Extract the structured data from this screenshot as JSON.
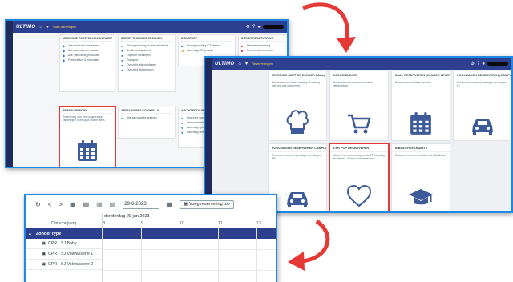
{
  "window1": {
    "logo": "ULTIMO",
    "breadcrumb": "Start Aanvragen",
    "panels": {
      "p1": {
        "title": "Medische toestellen/Ontwerpen",
        "rows": [
          "Alle medische aanvragen",
          "Alle aanvragen en status",
          "Alle (medische) producten",
          "Productfotos & informatie"
        ]
      },
      "p2": {
        "title": "Dienst technische zaken",
        "rows": [
          "Storingsmelding technische dienst",
          "Snelle werkopdracht",
          "Lopende meldingen",
          "Transport",
          "Overzicht alle meldingen",
          "Overzicht afwerkingen"
        ]
      },
      "p3": {
        "title": "Dienst ICT",
        "rows": [
          "Storingsmelding ICT dienst",
          "Aanvraag ICT product"
        ]
      },
      "p4": {
        "title": "Dienst reservering",
        "rows": [
          "Nieuwe reservering",
          "Reservering overzicht"
        ]
      },
      "p5": {
        "title": "Reserveringen",
        "desc": "Reservering voor een vergaderzaal, pandelegen, voertuig of andere items"
      },
      "p6": {
        "title": "Afdelingen/Legionella",
        "rows": [
          "Alle aanvraagformulieren"
        ]
      },
      "p7": {
        "title": "Architectuur & Beheer",
        "rows": [
          "Overzicht van aanvragen",
          "Werkadministratie",
          "Aanvraag oplossen",
          "Aanvraag verbeteren"
        ]
      }
    }
  },
  "window2": {
    "logo": "ULTIMO",
    "breadcrumb": "Reserveringen",
    "cards": [
      {
        "title": "Levering (niet of zonder zaal)",
        "desc": "Reserveren van alleen catering of catering met een zaal reservering",
        "icon": "chef-hat-icon"
      },
      {
        "title": "Uitleendienst",
        "desc": "Reserveren van een product uit de uitleendienst",
        "icon": "shopping-cart-icon"
      },
      {
        "title": "Zaal reserveren (zonder levering)",
        "desc": "Reserveren van alleen een zaal",
        "icon": "calendar-icon"
      },
      {
        "title": "Poolwagen reserveren (campus SJ)",
        "desc": "Reserveren van een poolwagen op campus SJ",
        "icon": "car-icon"
      },
      {
        "title": "Poolwagen reserveren campus MK",
        "desc": "Reserveren van een poolwagen op Campus MK",
        "icon": "car-icon"
      },
      {
        "title": "CPR POP reserveren",
        "desc": "Reserveren van een pop om de CPR-training te oefenen. Graag vooraf reserveren",
        "icon": "heart-icon"
      },
      {
        "title": "Bibliotheekruimte",
        "desc": "Reserveren van een ruimte in de bibliotheek",
        "icon": "graduation-cap-icon"
      }
    ]
  },
  "window3": {
    "date_value": "29-6-2023",
    "add_button": "Voeg reservering toe",
    "column_header": "Omschrijving",
    "day_label": "donderdag 29 jun 2023",
    "hours": [
      "8",
      "9",
      "10",
      "11",
      "12"
    ],
    "group_label": "Zonder type",
    "rows": [
      "CPR - SJ Baby",
      "CPR - SJ Volwassene 1",
      "CPR - SJ Volwassene 2"
    ]
  },
  "colors": {
    "topbar": "#2d3f8f",
    "sidebar": "#1f2b5a",
    "highlight": "#e53935",
    "window_border": "#1e88e5",
    "icon": "#3d5a99"
  }
}
